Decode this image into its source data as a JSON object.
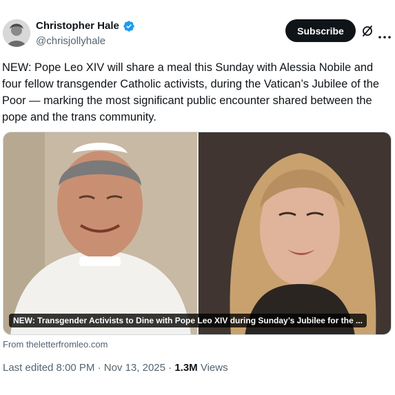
{
  "author": {
    "display_name": "Christopher Hale",
    "handle": "@chrisjollyhale",
    "verified": true,
    "avatar_icon": "user-avatar"
  },
  "actions": {
    "subscribe_label": "Subscribe",
    "grok_icon": "grok-icon",
    "more_icon": "more-icon"
  },
  "tweet": {
    "text": "NEW: Pope Leo XIV will share a meal this Sunday with Alessia Nobile and four fellow transgender Catholic activists, during the Vatican’s Jubilee of the Poor — marking the most significant public encounter shared between the pope and the trans community."
  },
  "card": {
    "caption": "NEW: Transgender Activists to Dine with Pope Leo XIV during Sunday’s Jubilee for the ...",
    "source": "From theletterfromleo.com"
  },
  "meta": {
    "last_edited": "Last edited 8:00 PM · Nov 13, 2025 · ",
    "views_count": "1.3M",
    "views_label": " Views"
  },
  "colors": {
    "text": "#0f1419",
    "secondary": "#536471",
    "verified": "#1d9bf0",
    "button_bg": "#0f1419"
  }
}
